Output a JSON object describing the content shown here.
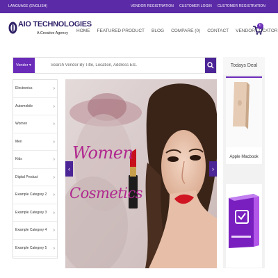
{
  "topbar": {
    "language": "LANGUAGE (ENGLISH)",
    "links": [
      "VENDOR REGISTRATION",
      "CUSTOMER LOGIN",
      "CUSTOMER REGISTRATION"
    ]
  },
  "brand": {
    "title": "AIO TECHNOLOGIES",
    "subtitle": "A Creative Agency"
  },
  "nav": {
    "items": [
      "HOME",
      "FEATURED PRODUCT",
      "BLOG",
      "COMPARE (0)",
      "CONTACT",
      "VENDOR LOCATOR"
    ]
  },
  "cart": {
    "count": "0",
    "icon": "cart-icon"
  },
  "search": {
    "vendor_label": "Vendor ▾",
    "placeholder": "Search Vendor By Title, Location, Address Etc.",
    "button_icon": "search-icon"
  },
  "categories": [
    "Electronics",
    "Automobile",
    "Women",
    "Men",
    "Kids",
    "Digital Product",
    "Example Category 2",
    "Example Category 3",
    "Example Category 4",
    "Example Category 5"
  ],
  "slider": {
    "line1": "Women",
    "line2": "Cosmetics",
    "prev_icon": "chevron-left-icon",
    "next_icon": "chevron-right-icon"
  },
  "deal": {
    "title": "Todays Deal",
    "item1_name": "Apple Macbook"
  },
  "colors": {
    "brand_purple": "#5b2aa6",
    "accent_purple": "#6a2bb9",
    "slider_text": "#b0288f"
  }
}
